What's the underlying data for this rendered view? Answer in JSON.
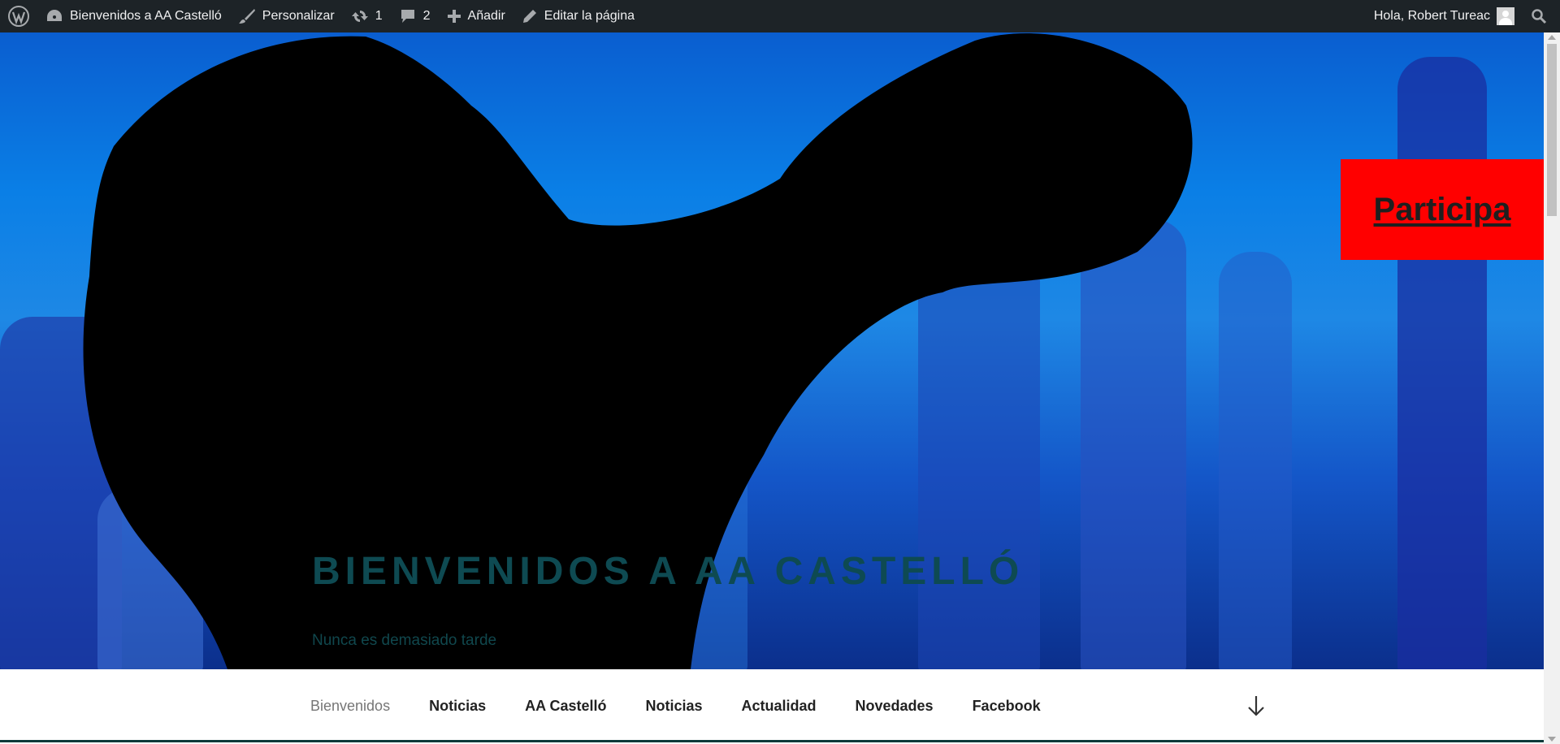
{
  "adminbar": {
    "site_name": "Bienvenidos a AA Castelló",
    "customize": "Personalizar",
    "updates_count": "1",
    "comments_count": "2",
    "new": "Añadir",
    "edit_page": "Editar la página",
    "greeting": "Hola, Robert Tureac",
    "icons": [
      "wordpress-logo-icon",
      "dashboard-icon",
      "brush-icon",
      "updates-icon",
      "comments-icon",
      "plus-icon",
      "pencil-icon",
      "avatar",
      "search-icon"
    ],
    "background": "#1d2327"
  },
  "hero": {
    "title": "Bienvenidos a AA Castelló",
    "tagline": "Nunca es demasiado tarde",
    "cta": "Participa",
    "cta_color": "#ff0000"
  },
  "nav": {
    "items": [
      {
        "label": "Bienvenidos",
        "current": true
      },
      {
        "label": "Noticias"
      },
      {
        "label": "AA Castelló"
      },
      {
        "label": "Noticias"
      },
      {
        "label": "Actualidad"
      },
      {
        "label": "Novedades"
      },
      {
        "label": "Facebook"
      }
    ],
    "scroll_icon": "arrow-down-icon"
  }
}
